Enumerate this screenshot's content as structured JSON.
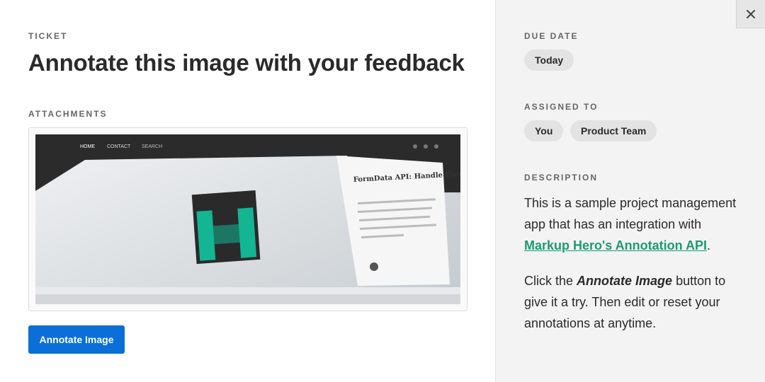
{
  "main": {
    "ticket_label": "TICKET",
    "title": "Annotate this image with your feedback",
    "attachments_label": "ATTACHMENTS",
    "thumbnail": {
      "nav": [
        "HOME",
        "CONTACT",
        "SEARCH"
      ],
      "card_title": "FormData API: Handle Forms like Boss"
    },
    "annotate_button": "Annotate Image"
  },
  "sidebar": {
    "due_label": "DUE DATE",
    "due_value": "Today",
    "assigned_label": "ASSIGNED TO",
    "assignees": [
      "You",
      "Product Team"
    ],
    "description_label": "DESCRIPTION",
    "description": {
      "p1_before": "This is a sample project management app that has an integration with ",
      "p1_link": "Markup Hero's Annotation API",
      "p1_after": ".",
      "p2_before": "Click the ",
      "p2_em": "Annotate Image",
      "p2_after": " button to give it a try. Then edit or reset your annotations at anytime."
    }
  },
  "colors": {
    "primary": "#0a6fd8",
    "link": "#1a9b73",
    "sidebar_bg": "#f3f3f3",
    "pill_bg": "#e3e3e3"
  },
  "icons": {
    "close": "close-icon"
  }
}
